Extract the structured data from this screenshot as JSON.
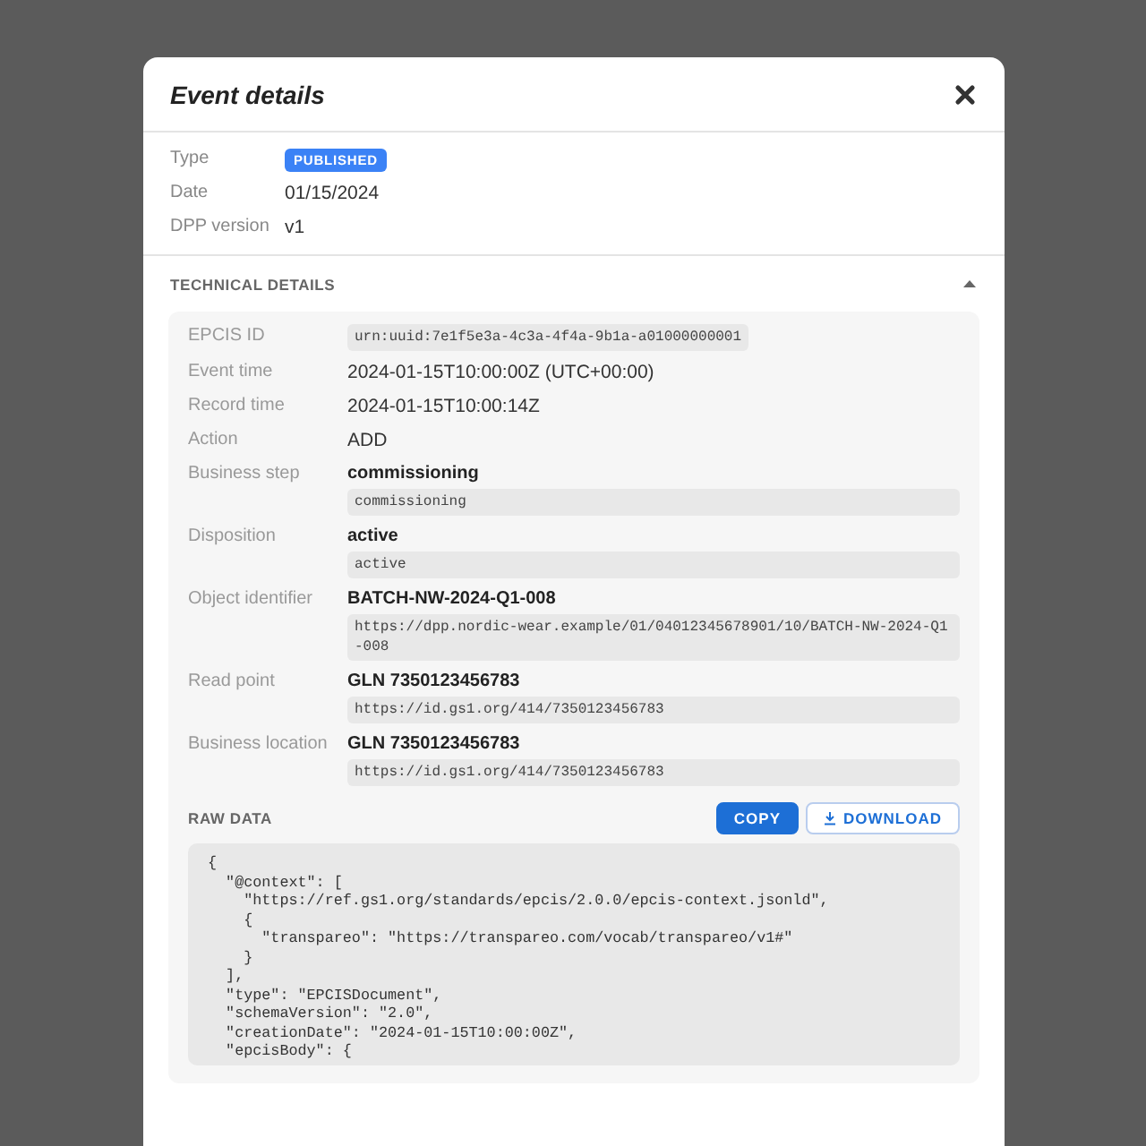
{
  "modal": {
    "title": "Event details"
  },
  "summary": [
    {
      "label": "Type",
      "kind": "badge",
      "value": "PUBLISHED",
      "color": "#3b82f6"
    },
    {
      "label": "Date",
      "kind": "text",
      "value": "01/15/2024"
    },
    {
      "label": "DPP version",
      "kind": "text",
      "value": "v1"
    }
  ],
  "technical": {
    "title": "TECHNICAL DETAILS",
    "expanded": true,
    "rows": [
      {
        "label": "EPCIS ID",
        "kind": "code",
        "code": "urn:uuid:7e1f5e3a-4c3a-4f4a-9b1a-a01000000001"
      },
      {
        "label": "Event time",
        "kind": "text",
        "value": "2024-01-15T10:00:00Z (UTC+00:00)"
      },
      {
        "label": "Record time",
        "kind": "text",
        "value": "2024-01-15T10:00:14Z"
      },
      {
        "label": "Action",
        "kind": "text",
        "value": "ADD"
      },
      {
        "label": "Business step",
        "kind": "detailed",
        "value": "commissioning",
        "code": "commissioning"
      },
      {
        "label": "Disposition",
        "kind": "detailed",
        "value": "active",
        "code": "active"
      },
      {
        "label": "Object identifier",
        "kind": "detailed",
        "value": "BATCH-NW-2024-Q1-008",
        "code": "https://dpp.nordic-wear.example/01/04012345678901/10/BATCH-NW-2024-Q1-008"
      },
      {
        "label": "Read point",
        "kind": "detailed",
        "value": "GLN 7350123456783",
        "code": "https://id.gs1.org/414/7350123456783"
      },
      {
        "label": "Business location",
        "kind": "detailed",
        "value": "GLN 7350123456783",
        "code": "https://id.gs1.org/414/7350123456783"
      }
    ],
    "raw_data": {
      "title": "RAW DATA",
      "copy_button": "COPY",
      "download_button": "DOWNLOAD",
      "lines": [
        "{",
        "  \"@context\": [",
        "    \"https://ref.gs1.org/standards/epcis/2.0.0/epcis-context.jsonld\",",
        "    {",
        "      \"transpareo\": \"https://transpareo.com/vocab/transpareo/v1#\"",
        "    }",
        "  ],",
        "  \"type\": \"EPCISDocument\",",
        "  \"schemaVersion\": \"2.0\",",
        "  \"creationDate\": \"2024-01-15T10:00:00Z\",",
        "  \"epcisBody\": {"
      ]
    }
  }
}
